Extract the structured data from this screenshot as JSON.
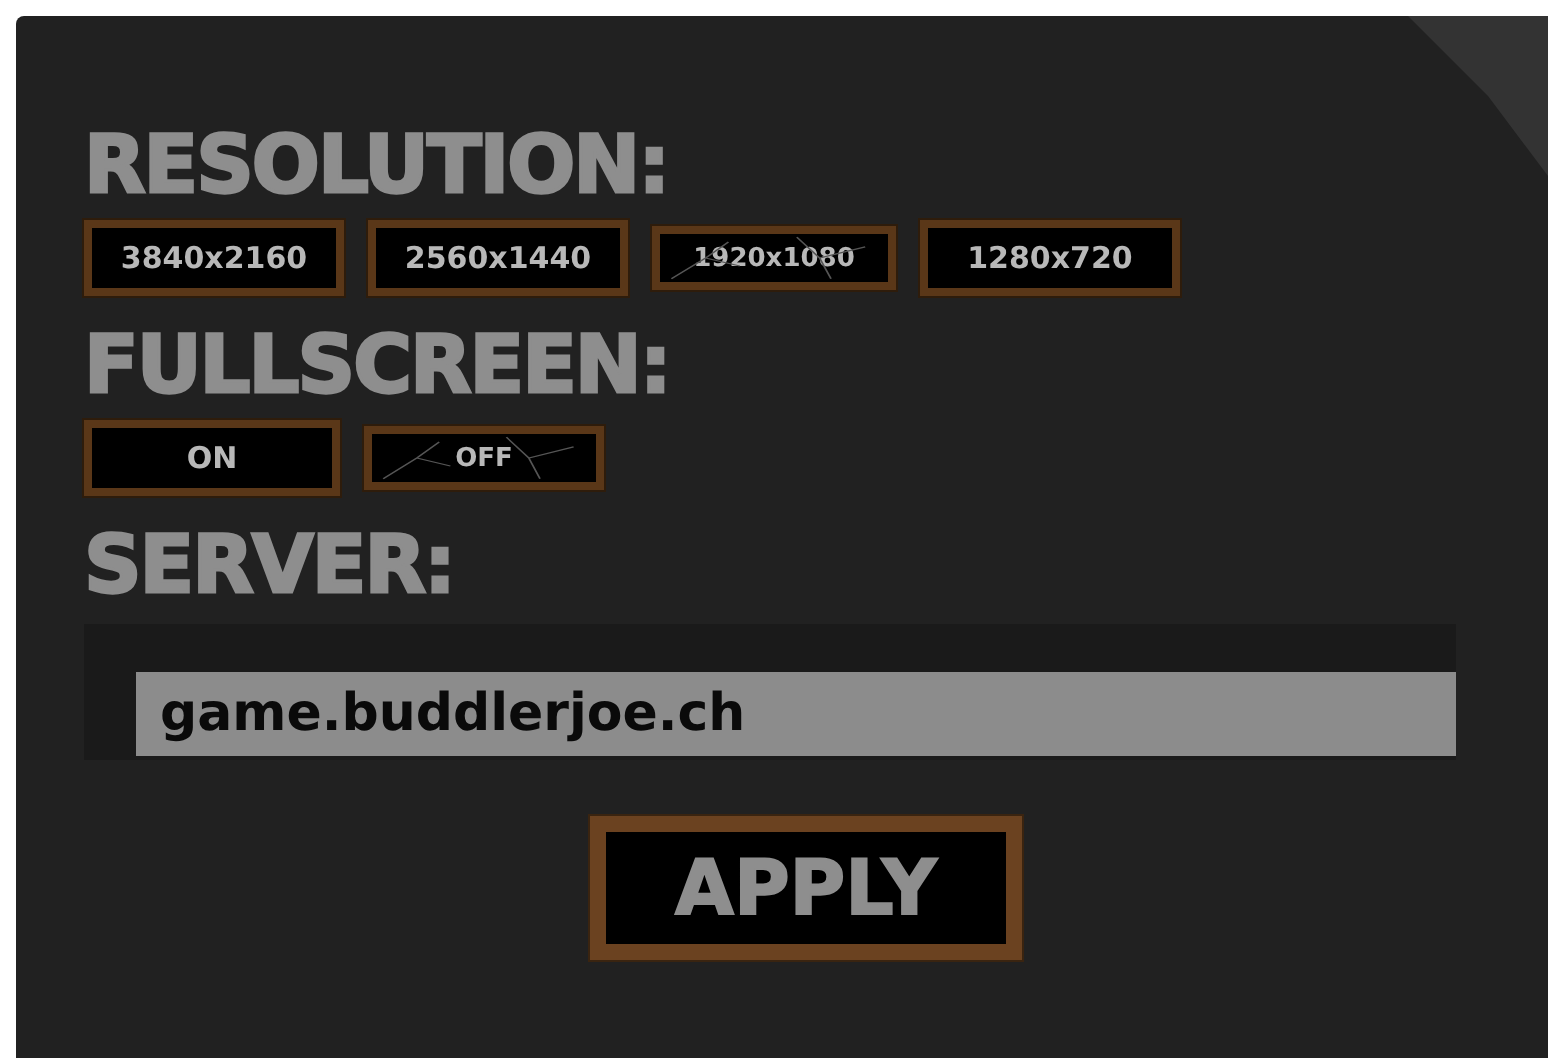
{
  "sections": [
    {
      "kind": "options",
      "heading": "RESOLUTION:",
      "options": [
        {
          "label": "3840x2160",
          "selected": false
        },
        {
          "label": "2560x1440",
          "selected": false
        },
        {
          "label": "1920x1080",
          "selected": true
        },
        {
          "label": "1280x720",
          "selected": false
        }
      ]
    },
    {
      "kind": "options",
      "heading": "FULLSCREEN:",
      "options": [
        {
          "label": "ON",
          "selected": false
        },
        {
          "label": "OFF",
          "selected": true
        }
      ]
    },
    {
      "kind": "field",
      "heading": "SERVER:",
      "value": "game.buddlerjoe.ch"
    }
  ],
  "apply": "APPLY"
}
